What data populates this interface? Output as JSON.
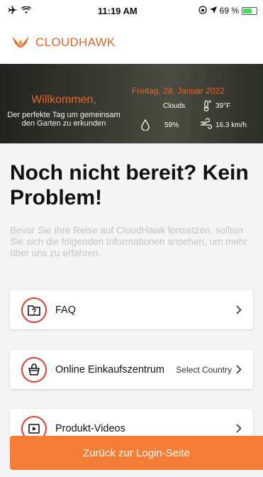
{
  "status_bar": {
    "time": "11:19 AM",
    "battery_percent": "69 %",
    "battery_level": 0.69,
    "icons": [
      "airplane-icon",
      "wifi-icon",
      "screen-lock-icon",
      "location-arrow-icon",
      "battery-charging-icon"
    ]
  },
  "header": {
    "brand": "CLOUDHAWK",
    "logo_icon": "hawk-logo-icon",
    "accent_color": "#e8632a"
  },
  "banner": {
    "welcome": "Willkommen,",
    "tagline": "Der perfekte Tag um gemeinsam den Garten zu erkunden",
    "date": "Freitag, 28. Januar 2022",
    "condition": "Clouds",
    "temperature": "39°F",
    "humidity": "59%",
    "wind": "16.3 km/h"
  },
  "main": {
    "title": "Noch nicht bereit? Kein Problem!",
    "subtitle": "Bevor Sie Ihre Reise auf CloudHawk fortsetzen, sollten Sie sich die folgenden Informationen ansehen, um mehr über uns zu erfahren."
  },
  "menu": [
    {
      "label": "FAQ",
      "icon": "faq-folder-icon",
      "extra": ""
    },
    {
      "label": "Online Einkaufszentrum",
      "icon": "shopping-basket-icon",
      "extra": "Select Country"
    },
    {
      "label": "Produkt-Videos",
      "icon": "video-play-icon",
      "extra": ""
    }
  ],
  "footer": {
    "login_button": "Zurück zur Login-Seite",
    "button_color": "#f47c34"
  }
}
